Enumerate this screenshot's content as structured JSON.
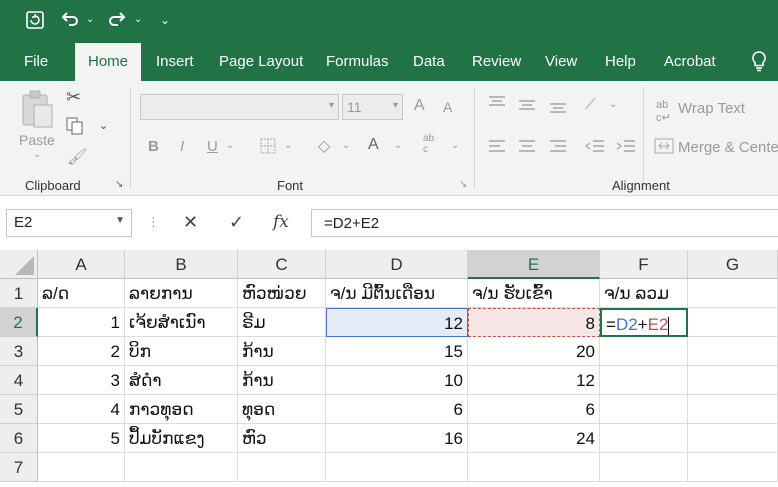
{
  "quick_access": {
    "autosave_icon": "autosave-icon",
    "undo_icon": "undo-icon",
    "redo_icon": "redo-icon",
    "customize_icon": "customize-icon"
  },
  "tabs": [
    "File",
    "Home",
    "Insert",
    "Page Layout",
    "Formulas",
    "Data",
    "Review",
    "View",
    "Help",
    "Acrobat"
  ],
  "ribbon": {
    "clipboard": {
      "paste": "Paste",
      "group": "Clipboard"
    },
    "font": {
      "name": "",
      "size": "11",
      "bold": "B",
      "italic": "I",
      "underline": "U",
      "group": "Font",
      "grow": "A",
      "shrink": "A",
      "color": "A"
    },
    "alignment": {
      "wrap": "Wrap Text",
      "merge": "Merge & Cente",
      "group": "Alignment"
    }
  },
  "formula_bar": {
    "namebox": "E2",
    "formula": "=D2+E2",
    "fx": "fx"
  },
  "columns": [
    "A",
    "B",
    "C",
    "D",
    "E",
    "F",
    "G"
  ],
  "rows": [
    "1",
    "2",
    "3",
    "4",
    "5",
    "6",
    "7"
  ],
  "cells": {
    "A1": "ລ/ດ",
    "B1": "ລາຍການ",
    "C1": "ຫົວໜ່ວຍ",
    "D1": "ຈ/ນ ມີຕົ້ນເດືອນ",
    "E1": "ຈ/ນ ຮັບເຂົ້າ",
    "F1": "ຈ/ນ ລວມ",
    "A2": "1",
    "B2": "ເຈ້ຍສຳເນົາ",
    "C2": "ຣີມ",
    "D2": "12",
    "E2": "8",
    "A3": "2",
    "B3": "ບິກ",
    "C3": "ກ້ານ",
    "D3": "15",
    "E3": "20",
    "A4": "3",
    "B4": "ສໍດຳ",
    "C4": "ກ້ານ",
    "D4": "10",
    "E4": "12",
    "A5": "4",
    "B5": "ກາວທຸອດ",
    "C5": "ທຸອດ",
    "D5": "6",
    "E5": "6",
    "A6": "5",
    "B6": "ປຶ້ມບັກແຂງ",
    "C6": "ຫົວ",
    "D6": "16",
    "E6": "24"
  },
  "edit_cell": {
    "eq": "=",
    "ref1": "D2",
    "plus": "+",
    "ref2": "E2"
  },
  "colors": {
    "brand": "#217346",
    "ref1": "#4472c4",
    "ref2": "#c0504d"
  }
}
